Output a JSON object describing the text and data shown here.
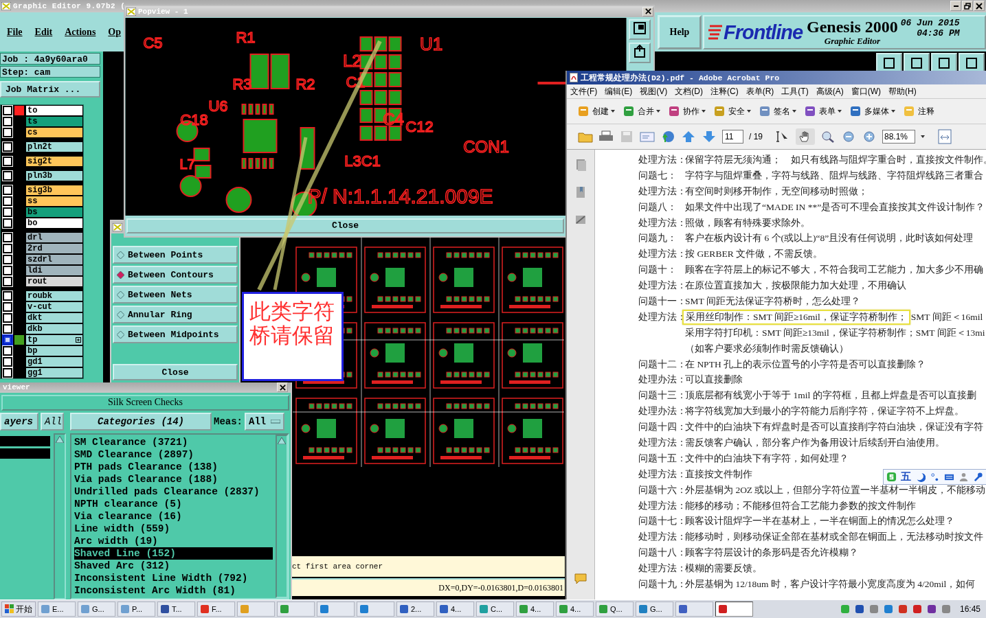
{
  "genesis": {
    "title": "Graphic Editor 9.07b2 (",
    "menu": [
      "File",
      "Edit",
      "Actions",
      "Op"
    ],
    "help": "Help",
    "brand": "Frontline",
    "product": "Genesis 2000",
    "date": "06 Jun 2015",
    "time": "04:36 PM",
    "subtitle": "Graphic Editor",
    "job": "Job : 4a9y60ara0",
    "step": "Step: cam",
    "job_matrix": "Job Matrix ...",
    "layer_groups": [
      {
        "layers": [
          {
            "name": "to",
            "color": "#ffffff",
            "swatch": {
              "color": "#ff2020"
            },
            "selected": false
          },
          {
            "name": "ts",
            "color": "#14a07c",
            "selected": false
          },
          {
            "name": "cs",
            "color": "#ffc65a",
            "selected": false
          }
        ]
      },
      {
        "layers": [
          {
            "name": "pln2t",
            "color": "#a0dcd8",
            "selected": false
          }
        ]
      },
      {
        "layers": [
          {
            "name": "sig2t",
            "color": "#ffc65a",
            "selected": false
          }
        ]
      },
      {
        "layers": [
          {
            "name": "pln3b",
            "color": "#a0dcd8",
            "selected": false
          }
        ]
      },
      {
        "layers": [
          {
            "name": "sig3b",
            "color": "#ffc65a",
            "selected": false
          },
          {
            "name": "ss",
            "color": "#ffc65a",
            "selected": false
          },
          {
            "name": "bs",
            "color": "#14a07c",
            "selected": false
          },
          {
            "name": "bo",
            "color": "#ffffff",
            "selected": false
          }
        ]
      },
      {
        "layers": [
          {
            "name": "drl",
            "color": "#a0b4bc",
            "selected": false
          },
          {
            "name": "2rd",
            "color": "#a0b4bc",
            "selected": false
          },
          {
            "name": "szdrl",
            "color": "#a0b4bc",
            "selected": false
          },
          {
            "name": "ldi",
            "color": "#a0b4bc",
            "selected": false
          },
          {
            "name": "rout",
            "color": "#d8d8d8",
            "selected": false
          }
        ]
      },
      {
        "layers": [
          {
            "name": "roubk",
            "color": "#a0dcd8",
            "selected": false
          },
          {
            "name": "v-cut",
            "color": "#a0dcd8",
            "selected": false
          },
          {
            "name": "dkt",
            "color": "#a0dcd8",
            "selected": false
          },
          {
            "name": "dkb",
            "color": "#a0dcd8",
            "selected": false
          },
          {
            "name": "tp",
            "color": "#a0dcd8",
            "swatch": {
              "color": "#44a020"
            },
            "selected": true
          },
          {
            "name": "bp",
            "color": "#a0dcd8",
            "selected": false
          },
          {
            "name": "gd1",
            "color": "#a0dcd8",
            "selected": false
          },
          {
            "name": "gg1",
            "color": "#a0dcd8",
            "selected": false
          }
        ]
      }
    ]
  },
  "popview": {
    "title": "Popview - 1",
    "labels": [
      "C5",
      "R1",
      "U1",
      "L2",
      "R3",
      "R2",
      "C1",
      "U6",
      "C18",
      "C4",
      "C12",
      "CON1",
      "L7",
      "L3C1",
      "P/ N:1.1.14.21.009E"
    ],
    "close": "Close"
  },
  "measure": {
    "items": [
      {
        "label": "Between Points",
        "selected": false
      },
      {
        "label": "Between Contours",
        "selected": true
      },
      {
        "label": "Between Nets",
        "selected": false
      },
      {
        "label": "Annular Ring",
        "selected": false
      },
      {
        "label": "Between Midpoints",
        "selected": false
      }
    ],
    "close": "Close"
  },
  "note": {
    "text": "此类字符桥请保留"
  },
  "viewer": {
    "title": "viewer",
    "header": "Silk Screen Checks",
    "layers_button": "ayers",
    "layers_all": "All",
    "categories_button": "Categories (14)",
    "meas_label": "Meas:",
    "meas_value": "All",
    "categories": [
      {
        "label": "SM Clearance (3721)",
        "selected": false
      },
      {
        "label": "SMD Clearance (2897)",
        "selected": false
      },
      {
        "label": "PTH pads Clearance (138)",
        "selected": false
      },
      {
        "label": "Via pads Clearance (188)",
        "selected": false
      },
      {
        "label": "Undrilled pads Clearance (2837)",
        "selected": false
      },
      {
        "label": "NPTH clearance (5)",
        "selected": false
      },
      {
        "label": "Via clearance (16)",
        "selected": false
      },
      {
        "label": "Line width (559)",
        "selected": false
      },
      {
        "label": "Arc width (19)",
        "selected": false
      },
      {
        "label": "Shaved Line (152)",
        "selected": true
      },
      {
        "label": "Shaved Arc (312)",
        "selected": false
      },
      {
        "label": "Inconsistent Line Width (792)",
        "selected": false
      },
      {
        "label": "Inconsistent Arc Width (81)",
        "selected": false
      }
    ]
  },
  "status": {
    "prompt": "ct first area corner",
    "coords": "DX=0,DY=-0.0163801,D=0.0163801"
  },
  "acrobat": {
    "title": "工程常规处理办法(D2).pdf - Adobe Acrobat Pro",
    "menu": [
      "文件(F)",
      "编辑(E)",
      "视图(V)",
      "文档(D)",
      "注释(C)",
      "表单(R)",
      "工具(T)",
      "高级(A)",
      "窗口(W)",
      "帮助(H)"
    ],
    "tools": [
      "创建",
      "合并",
      "协作",
      "安全",
      "签名",
      "表单",
      "多媒体",
      "注释"
    ],
    "page": "11",
    "pages": "/ 19",
    "zoom": "88.1%",
    "lines": [
      {
        "label": "处理方法：",
        "text": "保留字符层无须沟通；　如只有线路与阻焊字重合时，直接按文件制作。"
      },
      {
        "label": "问题七：",
        "text": "字符字与阻焊重叠，字符与线路、阻焊与线路、字符阻焊线路三者重合"
      },
      {
        "label": "处理方法：",
        "text": "有空间时则移开制作，无空间移动时照做；"
      },
      {
        "label": "问题八：",
        "text": "如果文件中出现了“MADE IN **”是否可不理会直接按其文件设计制作？"
      },
      {
        "label": "处理方法：",
        "text": "照做，顾客有特殊要求除外。"
      },
      {
        "label": "问题九：",
        "text": "客户在板内设计有 6 个(或以上)“8”且没有任何说明，此时该如何处理"
      },
      {
        "label": "处理方法：",
        "text": "按 GERBER 文件做，不需反馈。"
      },
      {
        "label": "问题十：",
        "text": "顾客在字符层上的标记不够大，不符合我司工艺能力，加大多少不用确"
      },
      {
        "label": "处理方法：",
        "text": "在原位置直接加大，按极限能力加大处理，不用确认"
      },
      {
        "label": "问题十一：",
        "text": "SMT 间距无法保证字符桥时，怎么处理？"
      },
      {
        "label": "处理方法：",
        "boxed": "采用丝印制作：SMT 间距≥16mil，保证字符桥制作；",
        "text": "SMT 间距＜16mil"
      },
      {
        "text": "采用字符打印机：SMT 间距≥13mil，保证字符桥制作；SMT 间距＜13mi"
      },
      {
        "text": "（如客户要求必须制作时需反馈确认）"
      },
      {
        "label": "问题十二：",
        "text": "在 NPTH 孔上的表示位置号的小字符是否可以直接删除？"
      },
      {
        "label": "处理办法：",
        "text": "可以直接删除"
      },
      {
        "label": "问题十三：",
        "text": "顶底层都有线宽小于等于 1mil 的字符框，且都上焊盘是否可以直接删"
      },
      {
        "label": "处理办法：",
        "text": "将字符线宽加大到最小的字符能力后削字符，保证字符不上焊盘。"
      },
      {
        "label": "问题十四：",
        "text": "文件中的白油块下有焊盘时是否可以直接削字符白油块，保证没有字符"
      },
      {
        "label": "处理方法：",
        "text": "需反馈客户确认，部分客户作为备用设计后续刮开白油使用。"
      },
      {
        "label": "问题十五：",
        "text": "文件中的白油块下有字符，如何处理？"
      },
      {
        "label": "处理方法：",
        "text": "直接按文件制作"
      },
      {
        "label": "问题十六：",
        "text": "外层基铜为 2OZ 或以上，但部分字符位置一半基材一半铜皮，不能移动"
      },
      {
        "label": "处理方法：",
        "text": "能移的移动；不能移但符合工艺能力参数的按文件制作"
      },
      {
        "label": "问题十七：",
        "text": "顾客设计阻焊字一半在基材上，一半在铜面上的情况怎么处理？"
      },
      {
        "label": "处理方法：",
        "text": "能移动时，则移动保证全部在基材或全部在铜面上，无法移动时按文件"
      },
      {
        "label": "问题十八：",
        "text": "顾客字符层设计的条形码是否允许模糊？"
      },
      {
        "label": "处理方法：",
        "text": "模糊的需要反馈。"
      },
      {
        "label": "问题十九：",
        "text": "外层基铜为 12/18um 时，客户设计字符最小宽度高度为 4/20mil，如何"
      }
    ]
  },
  "ime": {
    "label": "五"
  },
  "taskbar": {
    "start": "开始",
    "clock": "16:45",
    "items": [
      {
        "label": "E...",
        "selected": false
      },
      {
        "label": "G...",
        "selected": false
      },
      {
        "label": "P...",
        "selected": false
      },
      {
        "label": "T...",
        "selected": false
      },
      {
        "label": "F...",
        "selected": false
      },
      {
        "selected": false
      },
      {
        "selected": false
      },
      {
        "selected": false
      },
      {
        "selected": false
      },
      {
        "label": "2...",
        "selected": false
      },
      {
        "label": "4...",
        "selected": false
      },
      {
        "label": "C...",
        "selected": false
      },
      {
        "label": "4...",
        "selected": false
      },
      {
        "label": "4...",
        "selected": false
      },
      {
        "label": "Q...",
        "selected": false
      },
      {
        "label": "G...",
        "selected": false
      },
      {
        "selected": false
      },
      {
        "selected": true
      }
    ]
  }
}
